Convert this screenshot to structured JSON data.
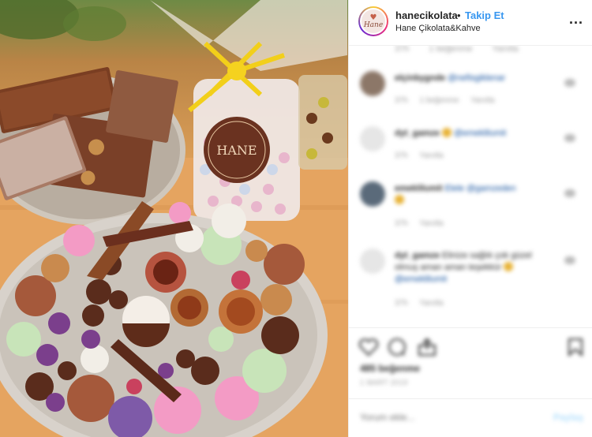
{
  "header": {
    "avatar_text": "Hane",
    "username": "hanecikolata",
    "separator": "•",
    "follow_label": "Takip Et",
    "location": "Hane Çikolata&Kahve",
    "more": "..."
  },
  "top_meta": {
    "time": "37h",
    "likes": "1 beğenme",
    "reply": "Yanıtla"
  },
  "comments": [
    {
      "user": "elçinbygnde",
      "text": "@nefisgiklenar",
      "time": "37h",
      "likes": "1 beğenme",
      "reply": "Yanıtla"
    },
    {
      "user": "dyt_gamze",
      "text": "@emeklilumit",
      "time": "37h",
      "reply": "Yanıtla"
    },
    {
      "user": "emeklilumit",
      "text": "Elele @gamzeden",
      "time": "37h",
      "reply": "Yanıtla"
    },
    {
      "user": "dyt_gamze",
      "text": "Elinize sağlık çok güzel olmuş aman aman teşekkür",
      "mention": "@emeklilumit",
      "time": "37h",
      "reply": "Yanıtla"
    }
  ],
  "actions": {
    "likes": "485 beğenme",
    "date": "1 MART 2019"
  },
  "add_comment": {
    "placeholder": "Yorum ekle...",
    "post_label": "Paylaş"
  },
  "colors": {
    "link": "#3897f0",
    "text": "#262626",
    "muted": "#999999",
    "post_disabled": "#b2dffc"
  },
  "icons": [
    "heart-icon",
    "comment-icon",
    "share-icon",
    "bookmark-icon",
    "more-icon",
    "emoji-icon"
  ]
}
